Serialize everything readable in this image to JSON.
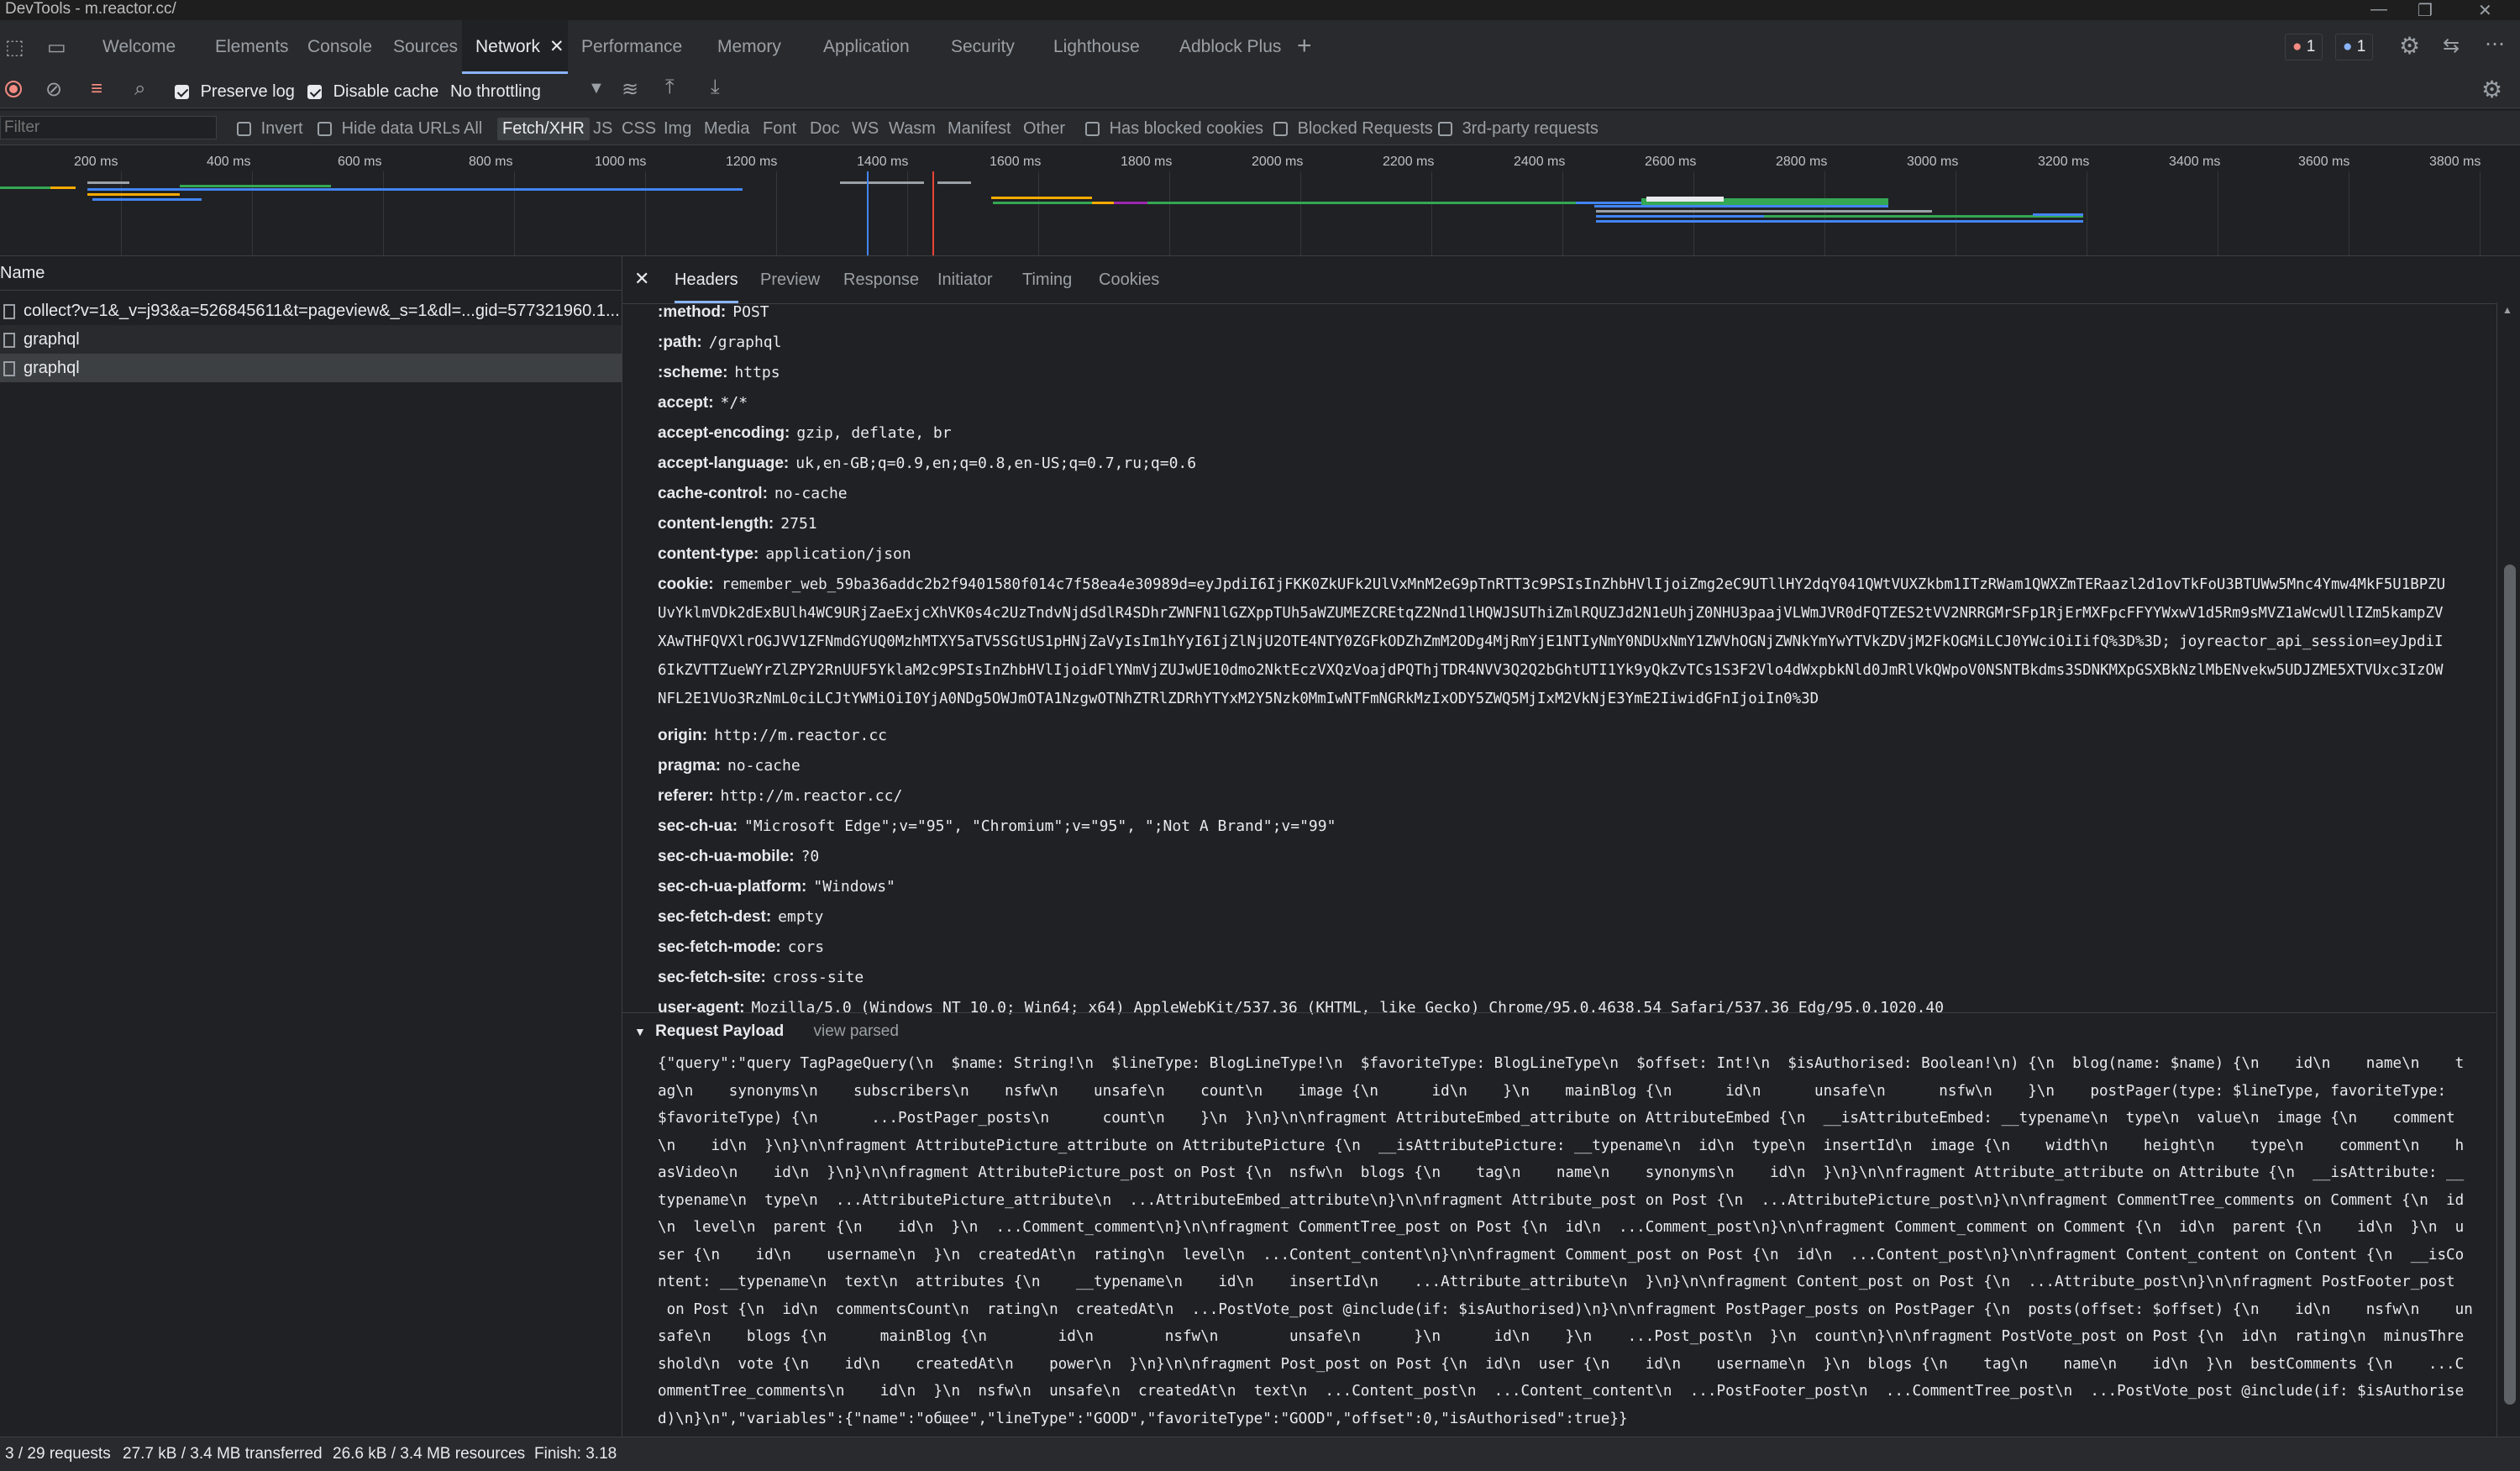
{
  "window": {
    "title": "DevTools - m.reactor.cc/"
  },
  "tabs": [
    "Welcome",
    "Elements",
    "Console",
    "Sources",
    "Network",
    "Performance",
    "Memory",
    "Application",
    "Security",
    "Lighthouse",
    "Adblock Plus"
  ],
  "badges": {
    "errors": "1",
    "messages": "1"
  },
  "toolbar": {
    "preserve_log": "Preserve log",
    "disable_cache": "Disable cache",
    "throttling": "No throttling"
  },
  "filter": {
    "placeholder": "Filter",
    "invert": "Invert",
    "hide_data_urls": "Hide data URLs",
    "types": [
      "All",
      "Fetch/XHR",
      "JS",
      "CSS",
      "Img",
      "Media",
      "Font",
      "Doc",
      "WS",
      "Wasm",
      "Manifest",
      "Other"
    ],
    "has_blocked_cookies": "Has blocked cookies",
    "blocked_requests": "Blocked Requests",
    "third_party": "3rd-party requests"
  },
  "timeline": {
    "ticks": [
      "200 ms",
      "400 ms",
      "600 ms",
      "800 ms",
      "1000 ms",
      "1200 ms",
      "1400 ms",
      "1600 ms",
      "1800 ms",
      "2000 ms",
      "2200 ms",
      "2400 ms",
      "2600 ms",
      "2800 ms",
      "3000 ms",
      "3200 ms",
      "3400 ms",
      "3600 ms",
      "3800 ms"
    ]
  },
  "requests": {
    "column": "Name",
    "items": [
      "collect?v=1&_v=j93&a=526845611&t=pageview&_s=1&dl=...gid=577321960.1...",
      "graphql",
      "graphql"
    ]
  },
  "details": {
    "tabs": [
      "Headers",
      "Preview",
      "Response",
      "Initiator",
      "Timing",
      "Cookies"
    ],
    "headers": [
      {
        "k": ":method:",
        "v": "POST"
      },
      {
        "k": ":path:",
        "v": "/graphql"
      },
      {
        "k": ":scheme:",
        "v": "https"
      },
      {
        "k": "accept:",
        "v": "*/*"
      },
      {
        "k": "accept-encoding:",
        "v": "gzip, deflate, br"
      },
      {
        "k": "accept-language:",
        "v": "uk,en-GB;q=0.9,en;q=0.8,en-US;q=0.7,ru;q=0.6"
      },
      {
        "k": "cache-control:",
        "v": "no-cache"
      },
      {
        "k": "content-length:",
        "v": "2751"
      },
      {
        "k": "content-type:",
        "v": "application/json"
      }
    ],
    "cookie_key": "cookie:",
    "cookie_lines": [
      "remember_web_59ba36addc2b2f9401580f014c7f58ea4e30989d=eyJpdiI6IjFKK0ZkUFk2UlVxMnM2eG9pTnRTT3c9PSIsInZhbHVlIjoiZmg2eC9UTllHY2dqY041QWtVUXZkbm1ITzRWam1QWXZmTERaazl2d1ovTkFoU3BTUWw5Mnc4Ymw4MkF5U1BPZU",
      "UvYklmVDk2dExBUlh4WC9URjZaeExjcXhVK0s4c2UzTndvNjdSdlR4SDhrZWNFN1lGZXppTUh5aWZUMEZCREtqZ2Nnd1lHQWJSUThiZmlRQUZJd2N1eUhjZ0NHU3paajVLWmJVR0dFQTZES2tVV2NRRGMrSFp1RjErMXFpcFFYYWxwV1d5Rm9sMVZ1aWcwUllIZm5kampZV",
      "XAwTHFQVXlrOGJVV1ZFNmdGYUQ0MzhMTXY5aTV5SGtUS1pHNjZaVyIsIm1hYyI6IjZlNjU2OTE4NTY0ZGFkODZhZmM2ODg4MjRmYjE1NTIyNmY0NDUxNmY1ZWVhOGNjZWNkYmYwYTVkZDVjM2FkOGMiLCJ0YWciOiIifQ%3D%3D; joyreactor_api_session=eyJpdiI",
      "6IkZVTTZueWYrZlZPY2RnUUF5YklaM2c9PSIsInZhbHVlIjoidFlYNmVjZUJwUE10dmo2NktEczVXQzVoajdPQThjTDR4NVV3Q2Q2bGhtUTI1Yk9yQkZvTCs1S3F2Vlo4dWxpbkNld0JmRlVkQWpoV0NSNTBkdms3SDNKMXpGSXBkNzlMbENvekw5UDJZME5XTVUxc3IzOW",
      "NFL2E1VUo3RzNmL0ciLCJtYWMiOiI0YjA0NDg5OWJmOTA1NzgwOTNhZTRlZDRhYTYxM2Y5Nzk0MmIwNTFmNGRkMzIxODY5ZWQ5MjIxM2VkNjE3YmE2IiwidGFnIjoiIn0%3D"
    ],
    "headers2": [
      {
        "k": "origin:",
        "v": "http://m.reactor.cc"
      },
      {
        "k": "pragma:",
        "v": "no-cache"
      },
      {
        "k": "referer:",
        "v": "http://m.reactor.cc/"
      },
      {
        "k": "sec-ch-ua:",
        "v": "\"Microsoft Edge\";v=\"95\", \"Chromium\";v=\"95\", \";Not A Brand\";v=\"99\""
      },
      {
        "k": "sec-ch-ua-mobile:",
        "v": "?0"
      },
      {
        "k": "sec-ch-ua-platform:",
        "v": "\"Windows\""
      },
      {
        "k": "sec-fetch-dest:",
        "v": "empty"
      },
      {
        "k": "sec-fetch-mode:",
        "v": "cors"
      },
      {
        "k": "sec-fetch-site:",
        "v": "cross-site"
      },
      {
        "k": "user-agent:",
        "v": "Mozilla/5.0 (Windows NT 10.0; Win64; x64) AppleWebKit/537.36 (KHTML, like Gecko) Chrome/95.0.4638.54 Safari/537.36 Edg/95.0.1020.40"
      }
    ],
    "payload_title": "Request Payload",
    "payload_view": "view parsed",
    "payload_lines": [
      "{\"query\":\"query TagPageQuery(\\n  $name: String!\\n  $lineType: BlogLineType!\\n  $favoriteType: BlogLineType\\n  $offset: Int!\\n  $isAuthorised: Boolean!\\n) {\\n  blog(name: $name) {\\n    id\\n    name\\n    t",
      "ag\\n    synonyms\\n    subscribers\\n    nsfw\\n    unsafe\\n    count\\n    image {\\n      id\\n    }\\n    mainBlog {\\n      id\\n      unsafe\\n      nsfw\\n    }\\n    postPager(type: $lineType, favoriteType:",
      "$favoriteType) {\\n      ...PostPager_posts\\n      count\\n    }\\n  }\\n}\\n\\nfragment AttributeEmbed_attribute on AttributeEmbed {\\n  __isAttributeEmbed: __typename\\n  type\\n  value\\n  image {\\n    comment",
      "\\n    id\\n  }\\n}\\n\\nfragment AttributePicture_attribute on AttributePicture {\\n  __isAttributePicture: __typename\\n  id\\n  type\\n  insertId\\n  image {\\n    width\\n    height\\n    type\\n    comment\\n    h",
      "asVideo\\n    id\\n  }\\n}\\n\\nfragment AttributePicture_post on Post {\\n  nsfw\\n  blogs {\\n    tag\\n    name\\n    synonyms\\n    id\\n  }\\n}\\n\\nfragment Attribute_attribute on Attribute {\\n  __isAttribute: __",
      "typename\\n  type\\n  ...AttributePicture_attribute\\n  ...AttributeEmbed_attribute\\n}\\n\\nfragment Attribute_post on Post {\\n  ...AttributePicture_post\\n}\\n\\nfragment CommentTree_comments on Comment {\\n  id",
      "\\n  level\\n  parent {\\n    id\\n  }\\n  ...Comment_comment\\n}\\n\\nfragment CommentTree_post on Post {\\n  id\\n  ...Comment_post\\n}\\n\\nfragment Comment_comment on Comment {\\n  id\\n  parent {\\n    id\\n  }\\n  u",
      "ser {\\n    id\\n    username\\n  }\\n  createdAt\\n  rating\\n  level\\n  ...Content_content\\n}\\n\\nfragment Comment_post on Post {\\n  id\\n  ...Content_post\\n}\\n\\nfragment Content_content on Content {\\n  __isCo",
      "ntent: __typename\\n  text\\n  attributes {\\n    __typename\\n    id\\n    insertId\\n    ...Attribute_attribute\\n  }\\n}\\n\\nfragment Content_post on Post {\\n  ...Attribute_post\\n}\\n\\nfragment PostFooter_post",
      " on Post {\\n  id\\n  commentsCount\\n  rating\\n  createdAt\\n  ...PostVote_post @include(if: $isAuthorised)\\n}\\n\\nfragment PostPager_posts on PostPager {\\n  posts(offset: $offset) {\\n    id\\n    nsfw\\n    un",
      "safe\\n    blogs {\\n      mainBlog {\\n        id\\n        nsfw\\n        unsafe\\n      }\\n      id\\n    }\\n    ...Post_post\\n  }\\n  count\\n}\\n\\nfragment PostVote_post on Post {\\n  id\\n  rating\\n  minusThre",
      "shold\\n  vote {\\n    id\\n    createdAt\\n    power\\n  }\\n}\\n\\nfragment Post_post on Post {\\n  id\\n  user {\\n    id\\n    username\\n  }\\n  blogs {\\n    tag\\n    name\\n    id\\n  }\\n  bestComments {\\n    ...C",
      "ommentTree_comments\\n    id\\n  }\\n  nsfw\\n  unsafe\\n  createdAt\\n  text\\n  ...Content_post\\n  ...Content_content\\n  ...PostFooter_post\\n  ...CommentTree_post\\n  ...PostVote_post @include(if: $isAuthorise",
      "d)\\n}\\n\",\"variables\":{\"name\":\"общее\",\"lineType\":\"GOOD\",\"favoriteType\":\"GOOD\",\"offset\":0,\"isAuthorised\":true}}"
    ]
  },
  "status": {
    "requests": "3 / 29 requests",
    "transferred": "27.7 kB / 3.4 MB transferred",
    "resources": "26.6 kB / 3.4 MB resources",
    "finish": "Finish: 3.18 s"
  },
  "colors": {
    "accent": "#8ab4f8",
    "record": "#f28b82"
  }
}
